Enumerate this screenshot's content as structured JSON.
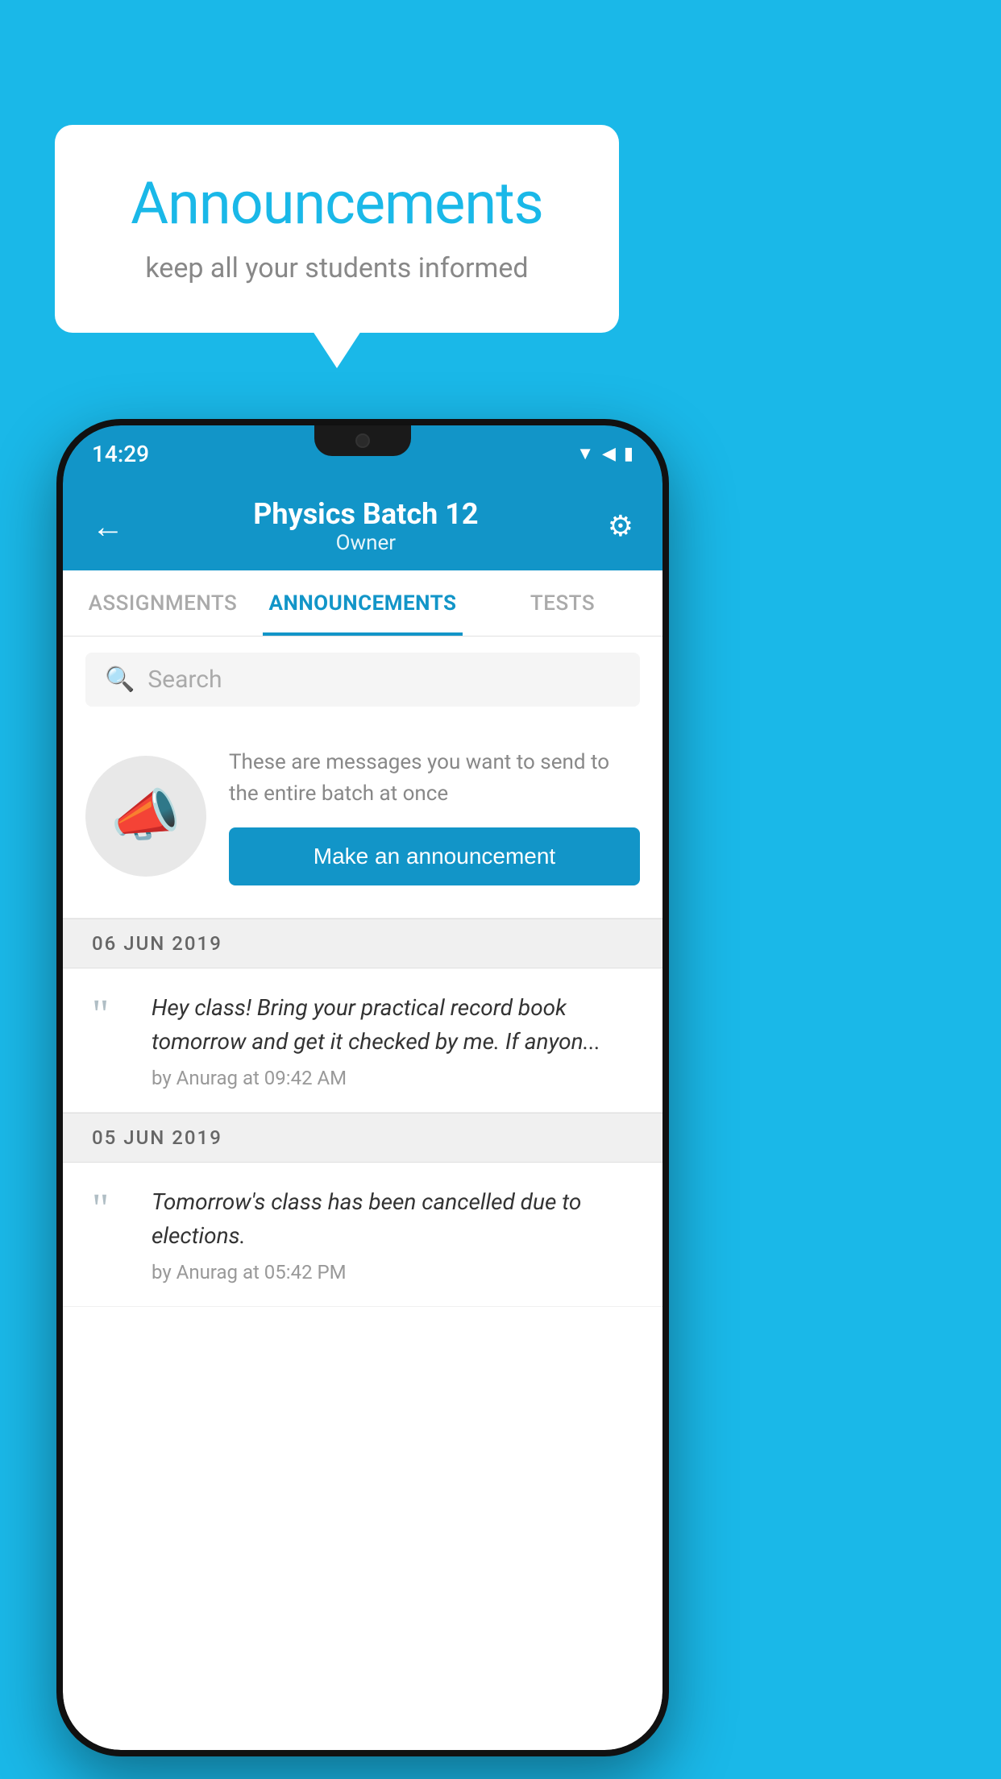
{
  "background_color": "#1ab8e8",
  "speech_bubble": {
    "title": "Announcements",
    "subtitle": "keep all your students informed"
  },
  "phone": {
    "status_bar": {
      "time": "14:29",
      "icons": [
        "wifi",
        "signal",
        "battery"
      ]
    },
    "header": {
      "title": "Physics Batch 12",
      "subtitle": "Owner",
      "back_label": "←",
      "gear_label": "⚙"
    },
    "tabs": [
      {
        "label": "ASSIGNMENTS",
        "active": false
      },
      {
        "label": "ANNOUNCEMENTS",
        "active": true
      },
      {
        "label": "TESTS",
        "active": false
      }
    ],
    "search": {
      "placeholder": "Search"
    },
    "promo": {
      "description": "These are messages you want to send to the entire batch at once",
      "button_label": "Make an announcement"
    },
    "announcements": [
      {
        "date": "06  JUN  2019",
        "message": "Hey class! Bring your practical record book tomorrow and get it checked by me. If anyon...",
        "meta": "by Anurag at 09:42 AM"
      },
      {
        "date": "05  JUN  2019",
        "message": "Tomorrow's class has been cancelled due to elections.",
        "meta": "by Anurag at 05:42 PM"
      }
    ]
  }
}
